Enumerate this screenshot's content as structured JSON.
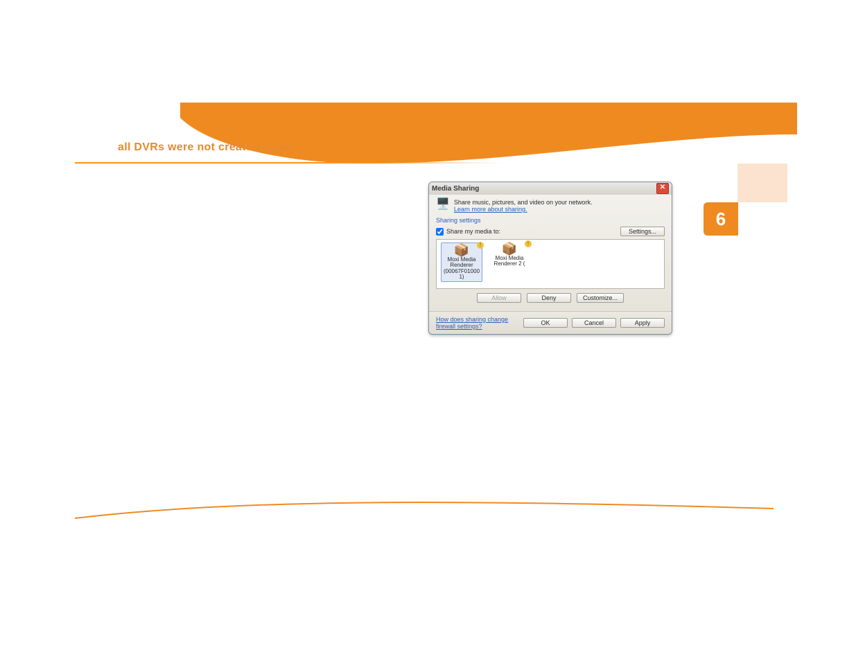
{
  "page": {
    "tagline": "all DVRs were not created equal",
    "page_number": "6"
  },
  "dialog": {
    "title": "Media Sharing",
    "intro_text": "Share music, pictures, and video on your network.",
    "learn_link": "Learn more about sharing.",
    "section_heading": "Sharing settings",
    "share_checkbox_label": "Share my media to:",
    "settings_button": "Settings...",
    "devices": [
      {
        "name_line1": "Moxi Media",
        "name_line2": "Renderer",
        "name_line3": "(00067F01000",
        "name_line4": "1)"
      },
      {
        "name_line1": "Moxi Media",
        "name_line2": "Renderer 2 (",
        "name_line3": "",
        "name_line4": ""
      }
    ],
    "allow_button": "Allow",
    "deny_button": "Deny",
    "customize_button": "Customize...",
    "footer_link": "How does sharing change firewall settings?",
    "ok_button": "OK",
    "cancel_button": "Cancel",
    "apply_button": "Apply"
  }
}
